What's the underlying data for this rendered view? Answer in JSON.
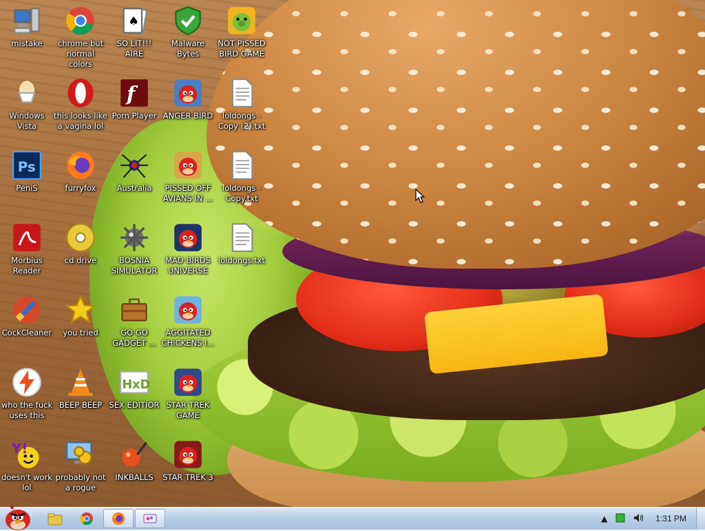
{
  "desktop": {
    "icons": [
      {
        "label": "mistake",
        "icon": "computer-icon",
        "color": "#c9c9c9"
      },
      {
        "label": "chrome but normal colors",
        "icon": "chrome-icon",
        "color": "#4285f4"
      },
      {
        "label": "SO LIT!!! AIRE",
        "icon": "solitaire-icon",
        "color": "#ffffff"
      },
      {
        "label": "Malware Bytes",
        "icon": "shield-check-icon",
        "color": "#3aa53a"
      },
      {
        "label": "NOT PISSED BIRD GAME",
        "icon": "green-pig-icon",
        "color": "#f2b41e"
      },
      {
        "label": "Windows Vista",
        "icon": "egg-cup-icon",
        "color": "#f4e0b0"
      },
      {
        "label": "this looks like a vagina lol",
        "icon": "opera-icon",
        "color": "#d11b1b"
      },
      {
        "label": "Porn Player",
        "icon": "flash-icon",
        "color": "#6b0d0d"
      },
      {
        "label": "ANGER BIRD",
        "icon": "red-bird-icon",
        "color": "#4a7fc4"
      },
      {
        "label": "loldongs - Copy (2).txt",
        "icon": "text-file-icon",
        "color": "#ffffff"
      },
      {
        "label": "PeniS",
        "icon": "photoshop-icon",
        "color": "#0b2a5a"
      },
      {
        "label": "furryfox",
        "icon": "firefox-icon",
        "color": "#ff7a1a"
      },
      {
        "label": "Australia",
        "icon": "spider-icon",
        "color": "#2b2b8a"
      },
      {
        "label": "PISSED OFF AVIANS IN ...",
        "icon": "seasons-bird-icon",
        "color": "#d9a54a"
      },
      {
        "label": "loldongs - Copy.txt",
        "icon": "text-file-icon",
        "color": "#ffffff"
      },
      {
        "label": "Morbius Reader",
        "icon": "pdf-reader-icon",
        "color": "#c8161b"
      },
      {
        "label": "cd drive",
        "icon": "cd-icon",
        "color": "#e0c23a"
      },
      {
        "label": "BOSNIA SIMULATOR",
        "icon": "mine-icon",
        "color": "#6d6d6d"
      },
      {
        "label": "MAD BIRDS UNIVERSE",
        "icon": "space-bird-icon",
        "color": "#1d3566"
      },
      {
        "label": "loldongs.txt",
        "icon": "text-file-icon",
        "color": "#ffffff"
      },
      {
        "label": "CockCleaner",
        "icon": "ccleaner-icon",
        "color": "#d64a2a"
      },
      {
        "label": "you tried",
        "icon": "star-icon",
        "color": "#f5cc1a"
      },
      {
        "label": "GO GO GADGET ...",
        "icon": "briefcase-icon",
        "color": "#b8742c"
      },
      {
        "label": "AGGITATED CHICKENS I...",
        "icon": "rio-bird-icon",
        "color": "#6db4e0"
      },
      {
        "label": "who the fuck uses this",
        "icon": "lightning-icon",
        "color": "#e8501a"
      },
      {
        "label": "BEEP BEEP",
        "icon": "vlc-cone-icon",
        "color": "#f28a1a"
      },
      {
        "label": "SEX EDITIOR",
        "icon": "hxd-icon",
        "color": "#ffffff"
      },
      {
        "label": "STAR TREK GAME",
        "icon": "star-wars-bird-icon",
        "color": "#2f4a8a"
      },
      {
        "label": "doesn't work lol",
        "icon": "yahoo-icon",
        "color": "#7b1fa2"
      },
      {
        "label": "probably not a rogue",
        "icon": "gears-monitor-icon",
        "color": "#4a90d9"
      },
      {
        "label": "INKBALLS",
        "icon": "inkball-icon",
        "color": "#e6501e"
      },
      {
        "label": "STAR TREK 3",
        "icon": "star-wars-bird-2-icon",
        "color": "#8a1a1a"
      }
    ]
  },
  "taskbar": {
    "start_icon": "angry-bird-start-icon",
    "pinned": [
      {
        "name": "explorer-icon",
        "active": false
      },
      {
        "name": "chrome-icon",
        "active": false
      },
      {
        "name": "firefox-icon",
        "active": true
      },
      {
        "name": "paint-icon",
        "active": true
      }
    ],
    "tray": {
      "expand": "▲",
      "clock": "1:31 PM"
    }
  }
}
